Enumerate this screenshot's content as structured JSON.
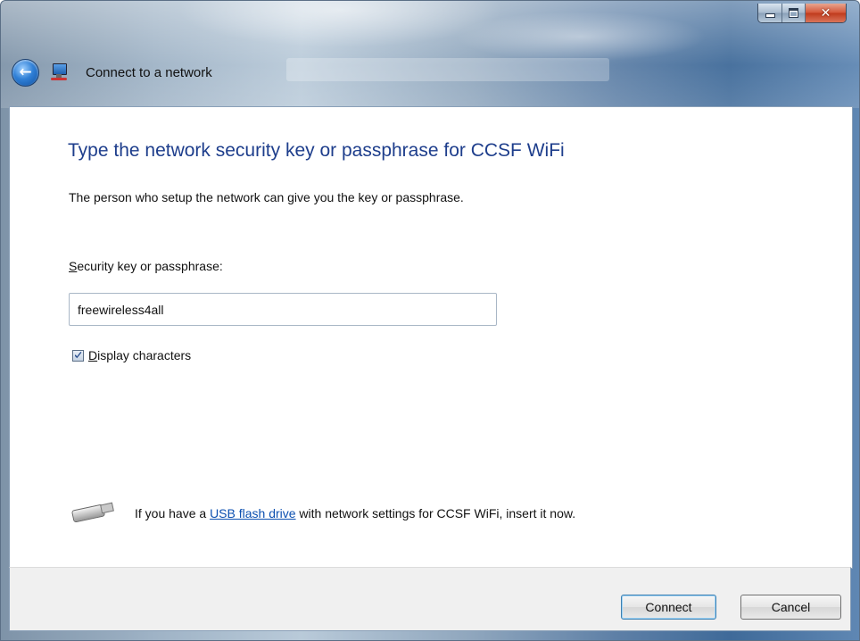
{
  "window": {
    "title": "Connect to a network",
    "caption_buttons": {
      "minimize_icon": "minimize-icon",
      "maximize_icon": "maximize-icon",
      "close_icon": "close-icon"
    }
  },
  "nav": {
    "back_icon": "back-arrow-icon",
    "app_icon": "network-icon",
    "title": "Connect to a network"
  },
  "main": {
    "heading": "Type the network security key or passphrase for CCSF WiFi",
    "description": "The person who setup the network can give you the key or passphrase.",
    "field_label_prefix": "S",
    "field_label_rest": "ecurity key or passphrase:",
    "key_value": "freewireless4all",
    "display_checkbox": {
      "checked": true,
      "label_prefix": "D",
      "label_rest": "isplay characters"
    },
    "usb_notice": {
      "icon": "usb-drive-icon",
      "before": "If you have a ",
      "link": "USB flash drive",
      "after": " with network settings for CCSF WiFi, insert it now."
    }
  },
  "footer": {
    "connect_label": "Connect",
    "cancel_label": "Cancel"
  },
  "colors": {
    "heading": "#1e3e8c",
    "link": "#0b4fb0",
    "close_button": "#c03b1d"
  }
}
